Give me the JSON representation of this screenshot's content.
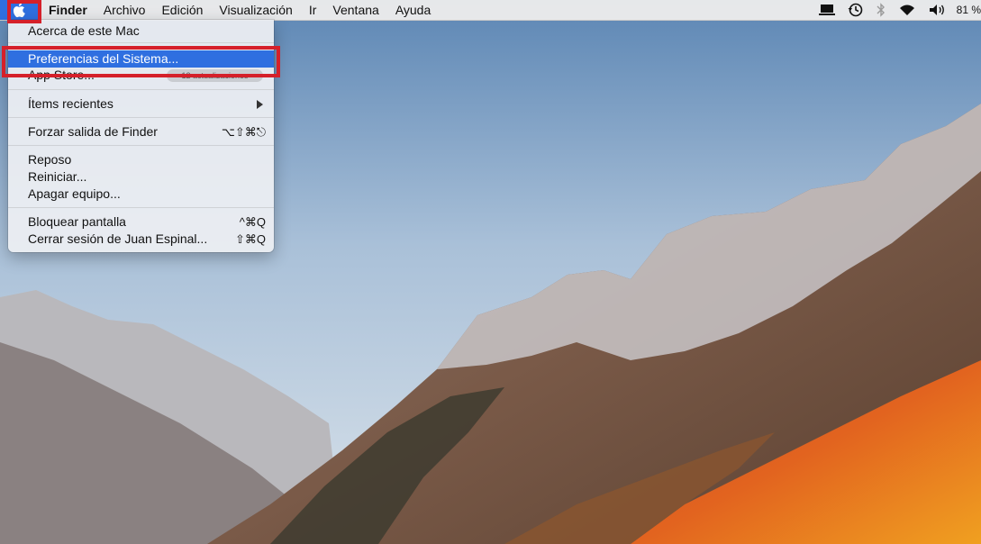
{
  "menubar": {
    "app_name": "Finder",
    "menus": [
      "Archivo",
      "Edición",
      "Visualización",
      "Ir",
      "Ventana",
      "Ayuda"
    ],
    "battery_text": "81 %",
    "status_icons": [
      "display-icon",
      "time-machine-icon",
      "bluetooth-icon",
      "wifi-icon",
      "volume-icon"
    ]
  },
  "apple_menu": {
    "items": {
      "about": "Acerca de este Mac",
      "prefs": "Preferencias del Sistema...",
      "appstore": "App Store...",
      "appstore_badge": "12 actualizaciones",
      "recent": "Ítems recientes",
      "force_quit": "Forzar salida de Finder",
      "force_quit_shortcut": "⌥⇧⌘⎋",
      "sleep": "Reposo",
      "restart": "Reiniciar...",
      "shutdown": "Apagar equipo...",
      "lock": "Bloquear pantalla",
      "lock_shortcut": "^⌘Q",
      "logout": "Cerrar sesión de Juan Espinal...",
      "logout_shortcut": "⇧⌘Q"
    }
  },
  "colors": {
    "selection": "#2f6fe0",
    "highlight": "#d5202a"
  }
}
